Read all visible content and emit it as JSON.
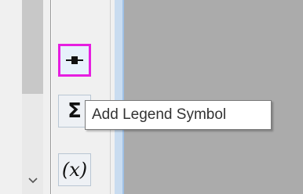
{
  "toolbar": {
    "buttons": [
      {
        "name": "add-legend-symbol",
        "glyph": "",
        "selected": true
      },
      {
        "name": "sum",
        "glyph": "Σ",
        "selected": false
      },
      {
        "name": "variable-x",
        "glyph": "(x)",
        "selected": false
      }
    ],
    "selected_color": "#e61ee0"
  },
  "tooltip": {
    "text": "Add Legend Symbol"
  },
  "colors": {
    "canvas": "#ababab",
    "panel": "#f0f0f0",
    "accent_strip": "#c9dcf0"
  }
}
